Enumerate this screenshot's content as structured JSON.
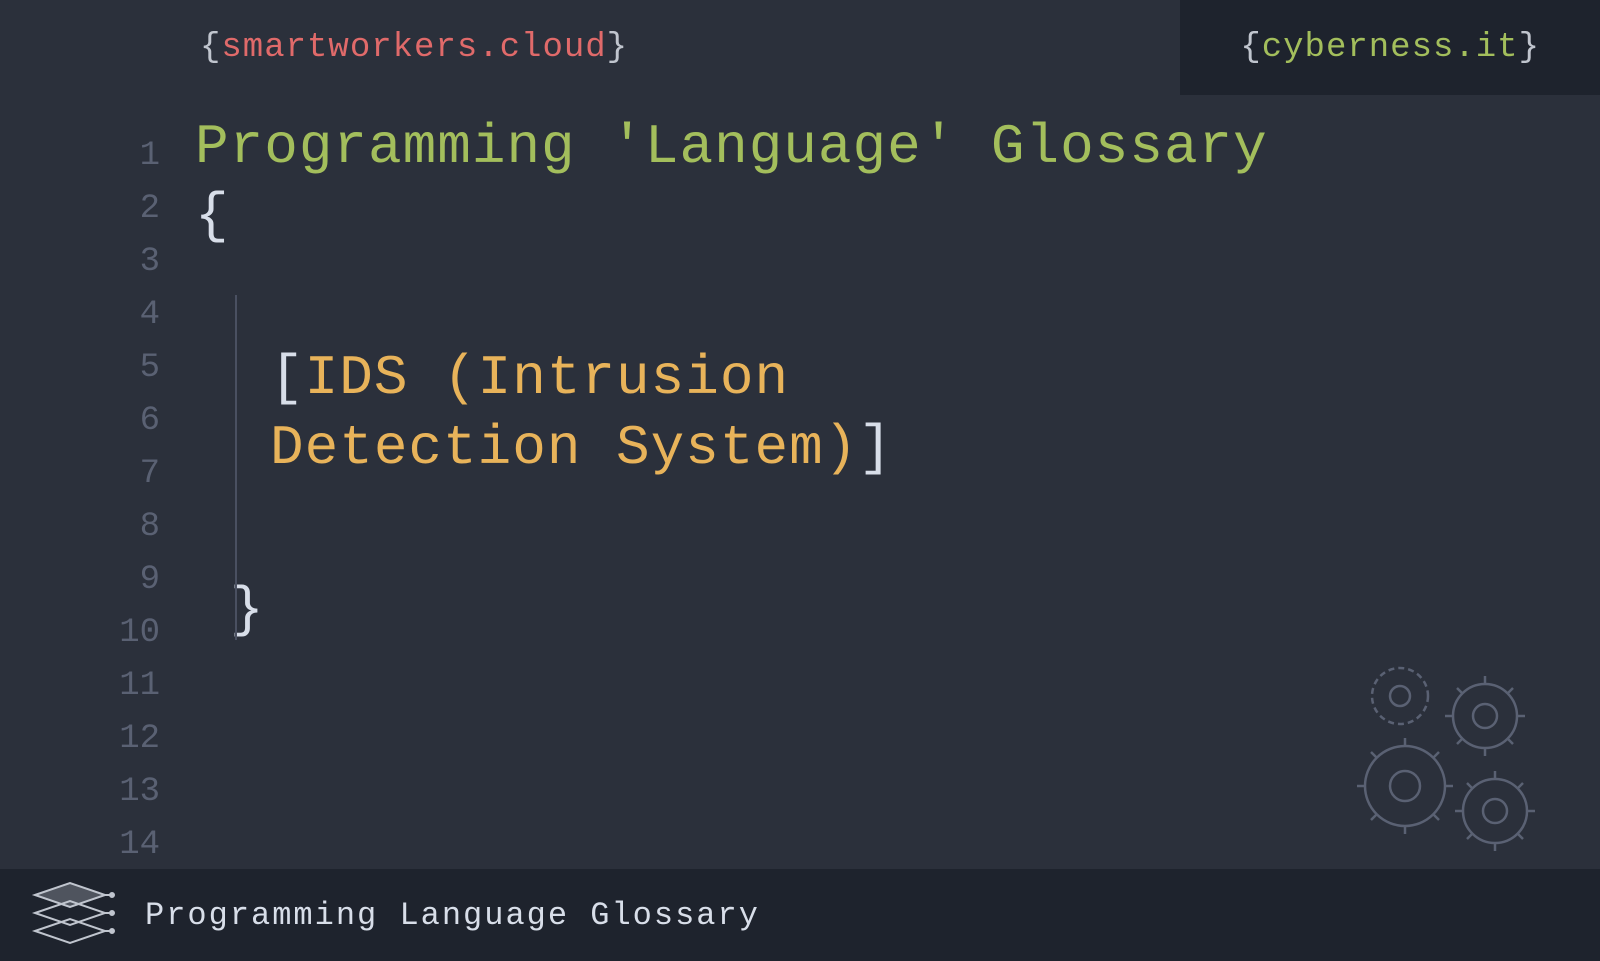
{
  "tabs": {
    "left": {
      "brace_open": "{",
      "text": "smartworkers.cloud",
      "brace_close": "}"
    },
    "right": {
      "brace_open": "{",
      "text": "cyberness.it",
      "brace_close": "}"
    }
  },
  "line_numbers": [
    "1",
    "2",
    "3",
    "4",
    "5",
    "6",
    "7",
    "8",
    "9",
    "10",
    "11",
    "12",
    "13",
    "14"
  ],
  "code": {
    "title": "Programming 'Language' Glossary",
    "open_brace": "{",
    "bracket_open": "[",
    "term_line1": "IDS (Intrusion",
    "term_line2": "Detection System)",
    "bracket_close": "]",
    "close_brace": "}"
  },
  "footer": {
    "text": "Programming Language Glossary"
  }
}
